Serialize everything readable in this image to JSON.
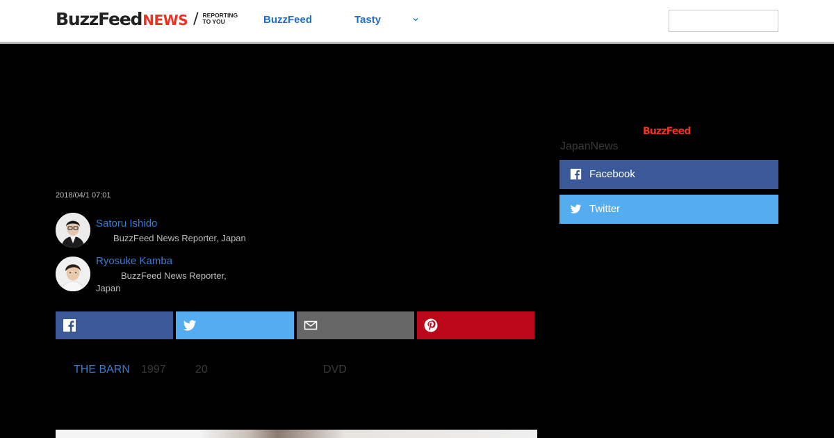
{
  "header": {
    "logo": {
      "buzz": "BuzzFeed",
      "news": "NEWS",
      "slash": "/",
      "tagline_1": "REPORTING",
      "tagline_2": "TO YOU"
    },
    "nav": [
      {
        "label": "BuzzFeed"
      },
      {
        "label": "Tasty"
      }
    ],
    "more_icon": "chevron-down-icon",
    "search": {
      "value": "",
      "placeholder": ""
    }
  },
  "article": {
    "date": "2018/04/1 07:01",
    "authors": [
      {
        "name": "Satoru Ishido",
        "role": "BuzzFeed News Reporter, Japan"
      },
      {
        "name": "Ryosuke Kamba",
        "role_line1": "BuzzFeed News Reporter,",
        "role_line2": "Japan"
      }
    ],
    "share_buttons": [
      {
        "name": "facebook",
        "icon": "facebook-icon",
        "color": "#3b5998"
      },
      {
        "name": "twitter",
        "icon": "twitter-icon",
        "color": "#55acee"
      },
      {
        "name": "email",
        "icon": "mail-icon",
        "color": "#666666"
      },
      {
        "name": "pinterest",
        "icon": "pinterest-icon",
        "color": "#bd081c"
      }
    ],
    "meta_line": {
      "link": "THE BARN",
      "year": "1997",
      "count": "20",
      "format": "DVD"
    }
  },
  "sidebar": {
    "logo": "BuzzFeed",
    "subtitle": "JapanNews",
    "follow_buttons": [
      {
        "label": "Facebook",
        "icon": "facebook-icon",
        "color": "#3b5998"
      },
      {
        "label": "Twitter",
        "icon": "twitter-icon",
        "color": "#55acee"
      }
    ]
  },
  "colors": {
    "link_blue": "#1f6ec8",
    "news_red": "#ee3322",
    "background": "#000000"
  }
}
